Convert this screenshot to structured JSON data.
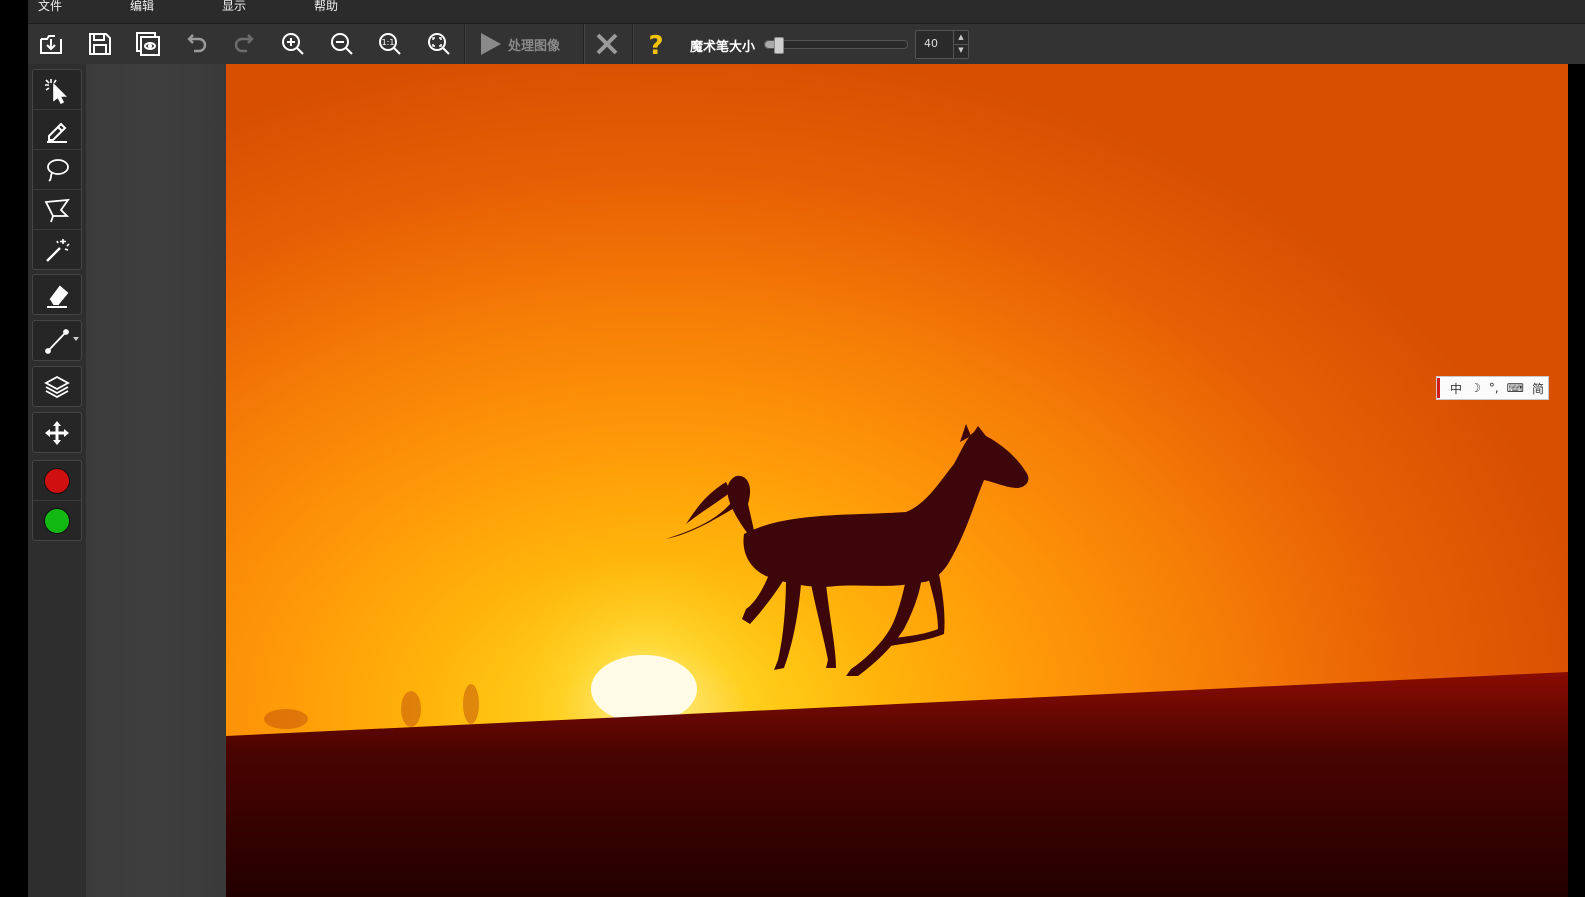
{
  "menu": {
    "items": [
      {
        "label": "文件"
      },
      {
        "label": "编辑"
      },
      {
        "label": "显示"
      },
      {
        "label": "帮助"
      }
    ]
  },
  "toolbar": {
    "buttons": [
      {
        "icon": "open-file-icon"
      },
      {
        "icon": "save-icon"
      },
      {
        "icon": "preview-icon"
      },
      {
        "icon": "undo-icon"
      },
      {
        "icon": "redo-icon"
      },
      {
        "icon": "zoom-in-icon"
      },
      {
        "icon": "zoom-out-icon"
      },
      {
        "icon": "actual-size-icon",
        "text": "1:1"
      },
      {
        "icon": "fit-screen-icon"
      }
    ],
    "process_label": "处理图像",
    "brush_size_label": "魔术笔大小",
    "brush_size_value": "40",
    "brush_size_fraction": 0.06
  },
  "tools": [
    {
      "icon": "smart-select-icon",
      "active": false
    },
    {
      "icon": "marker-pen-icon",
      "active": true
    },
    {
      "icon": "lasso-icon",
      "active": false
    },
    {
      "icon": "polygon-lasso-icon",
      "active": false
    },
    {
      "icon": "magic-wand-icon",
      "active": false
    },
    {
      "icon": "eraser-icon",
      "active": false
    },
    {
      "icon": "line-tool-icon",
      "active": false
    },
    {
      "icon": "layers-icon",
      "active": false
    },
    {
      "icon": "move-icon",
      "active": false
    }
  ],
  "colors": {
    "foreground": "#d01010",
    "background": "#12b812",
    "accent_yellow": "#f5c400"
  },
  "ime": {
    "mode": "中",
    "moon": "☽",
    "punct": "°,",
    "keyboard": "⌨",
    "script": "简"
  }
}
